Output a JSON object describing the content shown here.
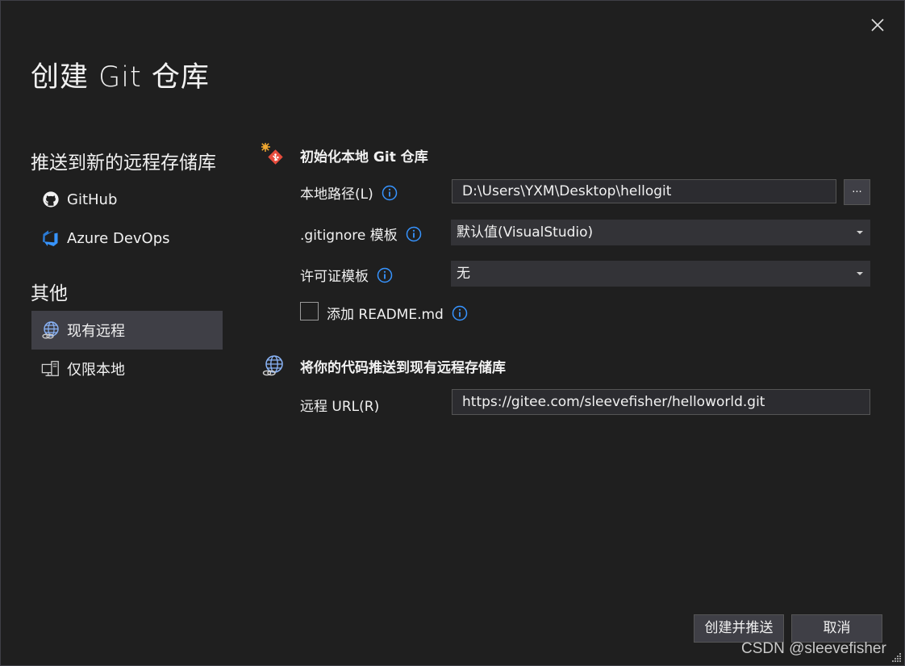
{
  "dialog": {
    "title": "创建 Git 仓库",
    "close_icon": "close-icon"
  },
  "sidebar": {
    "push_heading": "推送到新的远程存储库",
    "push_items": [
      {
        "label": "GitHub",
        "icon": "github-icon"
      },
      {
        "label": "Azure DevOps",
        "icon": "azure-devops-icon"
      }
    ],
    "other_heading": "其他",
    "other_items": [
      {
        "label": "现有远程",
        "icon": "existing-remote-icon",
        "selected": true
      },
      {
        "label": "仅限本地",
        "icon": "local-only-icon",
        "selected": false
      }
    ]
  },
  "init_group": {
    "heading": "初始化本地 Git 仓库",
    "icon": "git-init-icon",
    "local_path_label": "本地路径(L)",
    "local_path_value": "D:\\Users\\YXM\\Desktop\\hellogit",
    "browse_label": "...",
    "gitignore_label": ".gitignore 模板",
    "gitignore_value": "默认值(VisualStudio)",
    "license_label": "许可证模板",
    "license_value": "无",
    "readme_label": "添加 README.md",
    "readme_checked": false
  },
  "push_group": {
    "heading": "将你的代码推送到现有远程存储库",
    "icon": "globe-remote-icon",
    "remote_url_label": "远程 URL(R)",
    "remote_url_value": "https://gitee.com/sleevefisher/helloworld.git"
  },
  "footer": {
    "create_push_label": "创建并推送",
    "cancel_label": "取消"
  },
  "watermark": "CSDN @sleevefisher",
  "colors": {
    "background": "#1f1f1f",
    "selected": "#3f3f46",
    "accent_blue": "#3794ff",
    "git_red": "#e74c3c"
  }
}
